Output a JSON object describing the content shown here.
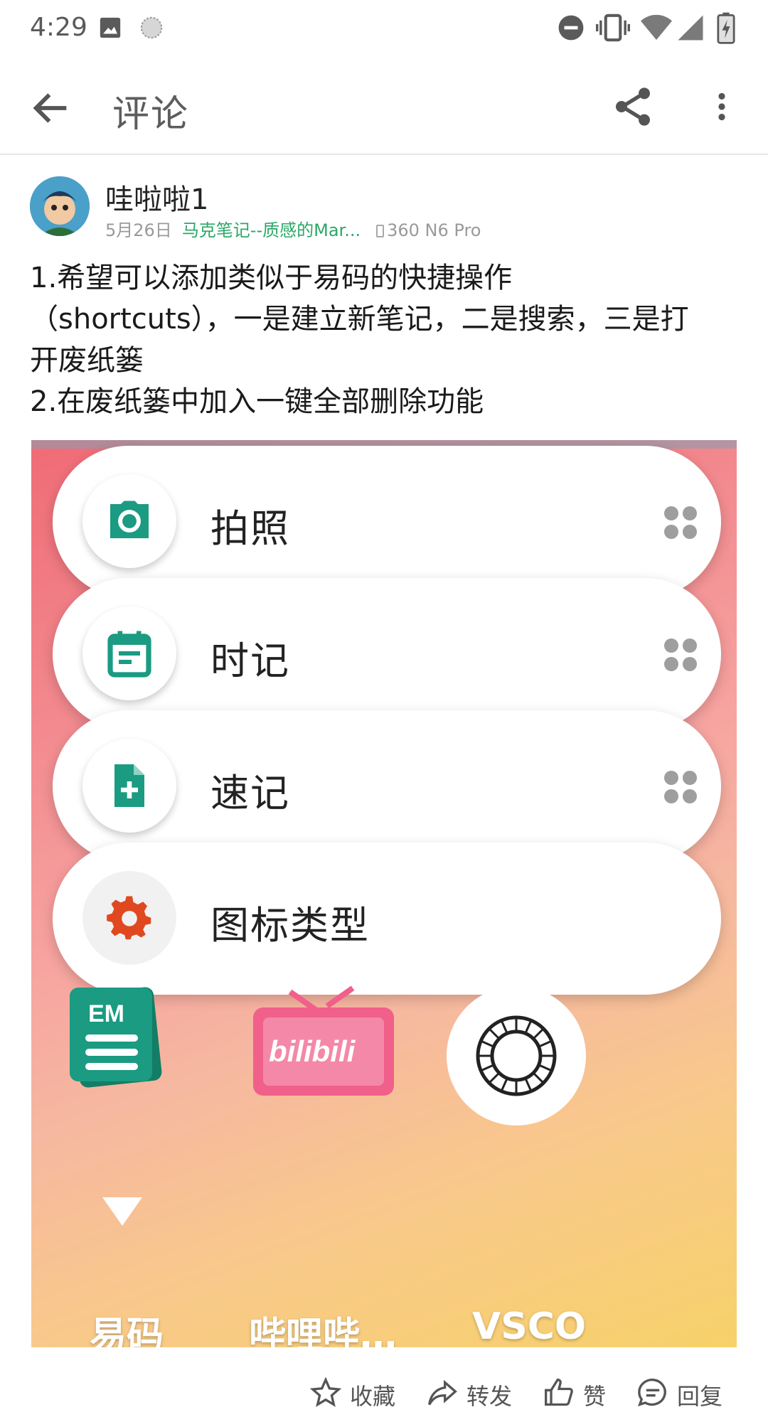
{
  "status_bar": {
    "time": "4:29",
    "icons": [
      "image-icon",
      "sync-icon",
      "do-not-disturb-icon",
      "vibrate-icon",
      "wifi-icon",
      "signal-icon",
      "battery-charging-icon"
    ]
  },
  "app_bar": {
    "title": "评论",
    "icons": [
      "arrow-back-icon",
      "share-icon",
      "more-vert-icon"
    ]
  },
  "comment": {
    "username": "哇啦啦1",
    "date": "5月26日",
    "source": "马克笔记--质感的Mar...",
    "device": "360 N6 Pro",
    "text_lines": [
      "1.希望可以添加类似于易码的快捷操作",
      "（shortcuts），一是建立新笔记，二是搜索，三是打",
      "开废纸篓",
      "2.在废纸篓中加入一键全部删除功能"
    ]
  },
  "screenshot": {
    "menu_items": [
      {
        "label": "拍照",
        "icon": "camera-icon"
      },
      {
        "label": "时记",
        "icon": "calendar-note-icon"
      },
      {
        "label": "速记",
        "icon": "add-document-icon"
      },
      {
        "label": "图标类型",
        "icon": "settings-gear-icon"
      }
    ],
    "apps": [
      {
        "label": "易码",
        "icon": "yima-app-icon"
      },
      {
        "label": "哔哩哔…",
        "icon": "bilibili-app-icon"
      },
      {
        "label": "VSCO",
        "icon": "vsco-app-icon"
      }
    ],
    "bilibili_logo_text": "bilibili",
    "yima_logo_text": "EM"
  },
  "actions": {
    "favorite": "收藏",
    "forward": "转发",
    "like": "赞",
    "reply": "回复"
  },
  "colors": {
    "teal_accent": "#1a9b82",
    "source_green": "#2aa866",
    "gear_orange": "#e0481f",
    "bilibili_pink": "#f0608a"
  }
}
